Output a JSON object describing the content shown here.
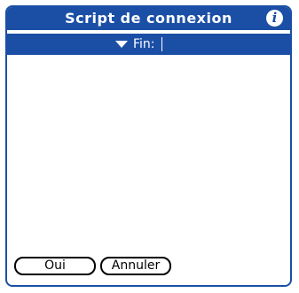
{
  "window": {
    "title": "Script de connexion",
    "info_icon": "info-icon"
  },
  "script": {
    "rows": [
      {
        "command": "Fin:",
        "selected": true,
        "trigger_icon": "triangle-down-icon"
      }
    ]
  },
  "buttons": {
    "ok_label": "Oui",
    "cancel_label": "Annuler"
  },
  "colors": {
    "accent": "#1b4fa6",
    "background": "#ffffff",
    "border": "#000000",
    "selected_text": "#ffffff"
  }
}
